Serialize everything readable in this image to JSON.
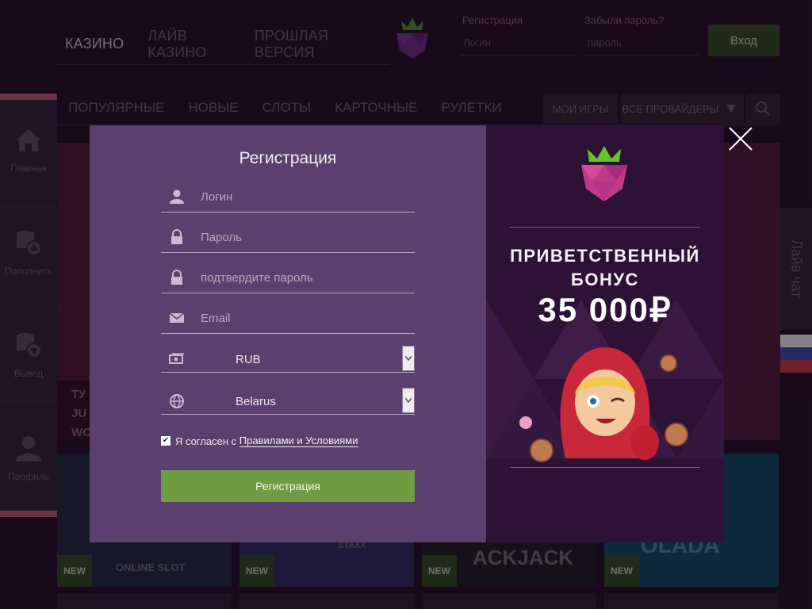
{
  "topnav": {
    "items": [
      "КАЗИНО",
      "ЛАЙВ КАЗИНО",
      "ПРОШЛАЯ ВЕРСИЯ"
    ]
  },
  "login": {
    "register_link": "Регистрация",
    "forgot_link": "Забыли пароль?",
    "login_placeholder": "Логин",
    "password_placeholder": "пароль",
    "enter_button": "Вход"
  },
  "categories": {
    "items": [
      "ПОПУЛЯРНЫЕ",
      "НОВЫЕ",
      "СЛОТЫ",
      "КАРТОЧНЫЕ",
      "РУЛЕТКИ"
    ],
    "my_games": "МОИ ИГРЫ",
    "all_providers": "ВСЕ ПРОВАЙДЕРЫ"
  },
  "sidebar": {
    "items": [
      {
        "label": "Главная",
        "icon": "home-icon"
      },
      {
        "label": "Пополнить",
        "icon": "deposit-icon"
      },
      {
        "label": "Вывод",
        "icon": "withdraw-icon"
      },
      {
        "label": "Профиль",
        "icon": "profile-icon"
      }
    ]
  },
  "banner": {
    "lines": [
      "TУ",
      "JU",
      "WO"
    ]
  },
  "tiles": [
    {
      "badge": "NEW",
      "caption": "ONLINE SLOT"
    },
    {
      "badge": "NEW",
      "caption": "STAXX"
    },
    {
      "badge": "NEW",
      "caption": "ACKJACK"
    },
    {
      "badge": "NEW",
      "caption": "OLADA"
    }
  ],
  "livechat": "Лайв чат",
  "modal": {
    "title": "Регистрация",
    "fields": {
      "login": "Логин",
      "password": "Пароль",
      "confirm": "подтвердите пароль",
      "email": "Email",
      "currency": "RUB",
      "country": "Belarus"
    },
    "agree_prefix": "Я согласен с ",
    "agree_link": "Правилами и Условиями",
    "submit": "Регистрация"
  },
  "promo": {
    "line1": "ПРИВЕТСТВЕННЫЙ",
    "line2": "БОНУС",
    "amount": "35 000₽"
  },
  "colors": {
    "accent_green": "#6f9b42",
    "brand_pink": "#d04a8c",
    "modal_left": "#5b3f6e",
    "modal_right": "#2e1236"
  }
}
